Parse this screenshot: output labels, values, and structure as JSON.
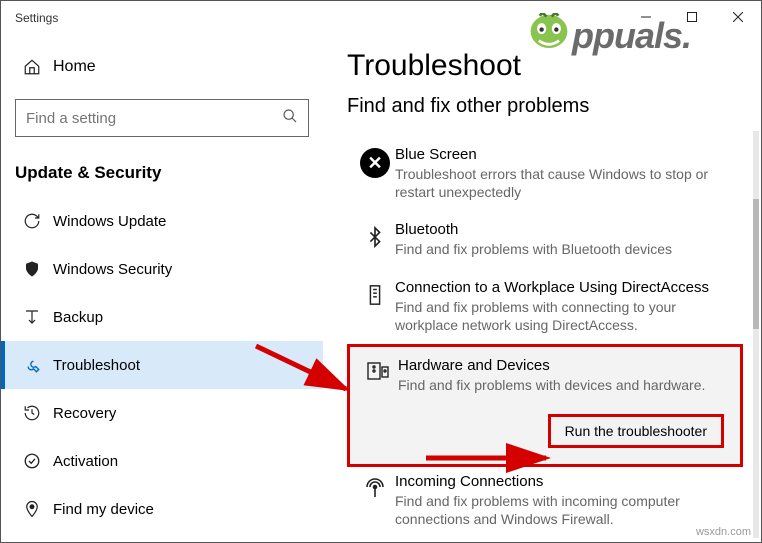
{
  "window": {
    "title": "Settings"
  },
  "sidebar": {
    "home": "Home",
    "search_placeholder": "Find a setting",
    "section": "Update & Security",
    "items": [
      {
        "label": "Windows Update"
      },
      {
        "label": "Windows Security"
      },
      {
        "label": "Backup"
      },
      {
        "label": "Troubleshoot"
      },
      {
        "label": "Recovery"
      },
      {
        "label": "Activation"
      },
      {
        "label": "Find my device"
      }
    ]
  },
  "content": {
    "title": "Troubleshoot",
    "subtitle": "Find and fix other problems",
    "troubleshooters": [
      {
        "title": "Blue Screen",
        "desc": "Troubleshoot errors that cause Windows to stop or restart unexpectedly"
      },
      {
        "title": "Bluetooth",
        "desc": "Find and fix problems with Bluetooth devices"
      },
      {
        "title": "Connection to a Workplace Using DirectAccess",
        "desc": "Find and fix problems with connecting to your workplace network using DirectAccess."
      },
      {
        "title": "Hardware and Devices",
        "desc": "Find and fix problems with devices and hardware."
      },
      {
        "title": "Incoming Connections",
        "desc": "Find and fix problems with incoming computer connections and Windows Firewall."
      }
    ],
    "run_button": "Run the troubleshooter"
  },
  "watermark": {
    "text": "ppuals."
  },
  "attribution": "wsxdn.com"
}
